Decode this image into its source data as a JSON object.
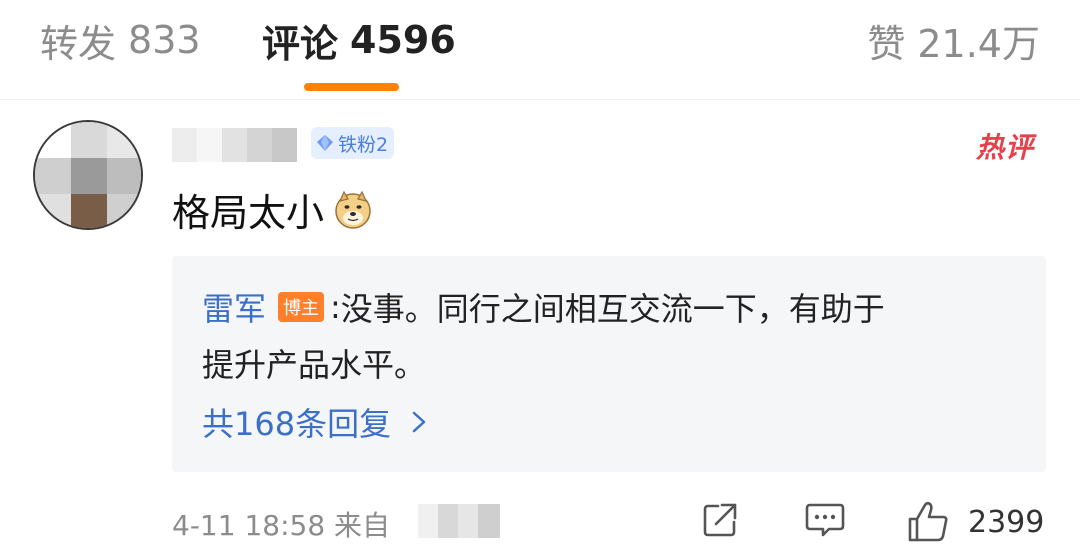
{
  "tabs": {
    "reposts": {
      "label": "转发",
      "count": "833"
    },
    "comments": {
      "label": "评论",
      "count": "4596"
    },
    "likes": {
      "label": "赞",
      "count": "21.4万"
    }
  },
  "comment": {
    "fan_badge": "铁粉2",
    "hot_tag": "热评",
    "text": "格局太小",
    "emoji": "doge-emoji",
    "reply": {
      "author": "雷军",
      "author_badge": "博主",
      "colon": ":",
      "text_line1": "没事。同行之间相互交流一下，有助于",
      "text_line2": "提升产品水平。",
      "more_label": "共168条回复"
    },
    "timestamp": "4-11 18:58 来自",
    "like_count": "2399"
  },
  "colors": {
    "accent": "#ff8200",
    "link": "#3c70c8",
    "hot": "#e8404a",
    "host_badge": "#ff7f2a",
    "fan_badge_bg": "#e6efff"
  }
}
